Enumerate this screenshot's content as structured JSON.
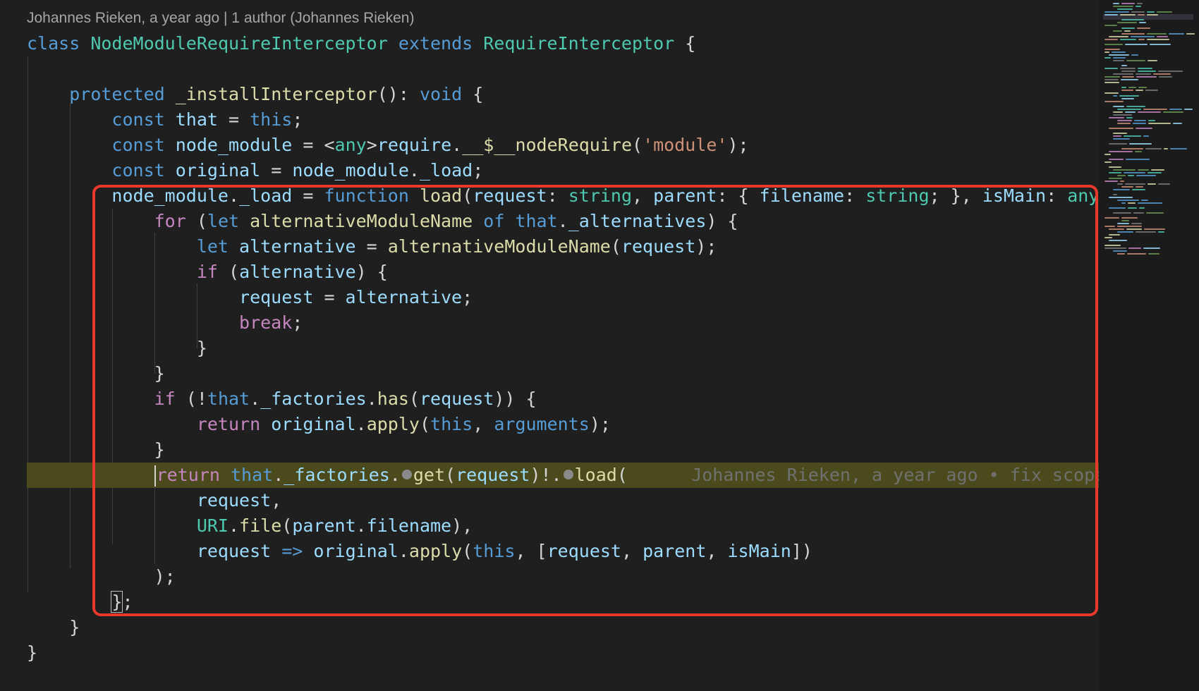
{
  "codelens": "Johannes Rieken, a year ago | 1 author (Johannes Rieken)",
  "blame_inline": "Johannes Rieken, a year ago • fix scope wh",
  "code": {
    "l1": {
      "kw": "class",
      "name": "NodeModuleRequireInterceptor",
      "ext": "extends",
      "base": "RequireInterceptor",
      "brace": "{"
    },
    "l3": {
      "mod": "protected",
      "fn": "_installInterceptor",
      "sig": "(): ",
      "ret": "void",
      "brace": "{"
    },
    "l4": {
      "kw": "const",
      "v": "that",
      "eq": " = ",
      "this": "this",
      "end": ";"
    },
    "l5": {
      "kw": "const",
      "v": "node_module",
      "eq": " = <",
      "type": "any",
      "gt": ">",
      "obj": "require",
      "dot": ".",
      "fn": "__$__nodeRequire",
      "open": "(",
      "str": "'module'",
      "close": ");"
    },
    "l6": {
      "kw": "const",
      "v": "original",
      "eq": " = ",
      "obj": "node_module",
      "dot": ".",
      "prop": "_load",
      "end": ";"
    },
    "l7": {
      "obj": "node_module",
      "dot": ".",
      "prop": "_load",
      "eq": " = ",
      "kw": "function",
      "fn": "load",
      "p1": "request",
      "t1": "string",
      "p2": "parent",
      "p3": "filename",
      "t3": "string",
      "p4": "isMain",
      "t4": "any",
      "brace": "{"
    },
    "l8": {
      "kw": "for",
      "kw2": "let",
      "v": "alternativeModuleName",
      "of": "of",
      "that": "that",
      "prop": "_alternatives"
    },
    "l9": {
      "kw": "let",
      "v": "alternative",
      "fn": "alternativeModuleName",
      "arg": "request"
    },
    "l10": {
      "kw": "if",
      "v": "alternative"
    },
    "l11": {
      "v": "request",
      "v2": "alternative"
    },
    "l12": {
      "kw": "break"
    },
    "l13": {
      "brace": "}"
    },
    "l14": {
      "brace": "}"
    },
    "l15": {
      "kw": "if",
      "that": "that",
      "prop": "_factories",
      "fn": "has",
      "arg": "request"
    },
    "l16": {
      "kw": "return",
      "obj": "original",
      "fn": "apply",
      "this": "this",
      "args": "arguments"
    },
    "l17": {
      "brace": "}"
    },
    "l18": {
      "kw": "return",
      "that": "that",
      "prop": "_factories",
      "fn": "get",
      "arg": "request",
      "fn2": "load"
    },
    "l19": {
      "v": "request"
    },
    "l20": {
      "cls": "URI",
      "fn": "file",
      "obj": "parent",
      "prop": "filename"
    },
    "l21": {
      "v": "request",
      "arrow": "=>",
      "obj": "original",
      "fn": "apply",
      "this": "this",
      "a1": "request",
      "a2": "parent",
      "a3": "isMain"
    },
    "l22": {
      "close": ");"
    },
    "l23": {
      "brace": "}",
      "end": ";"
    },
    "l24": {
      "brace": "}"
    },
    "l25": {
      "brace": "}"
    }
  },
  "colors": {
    "highlight_box": "#e8392c",
    "blame_line": "#4b4a1c",
    "background": "#1f1f1f"
  }
}
